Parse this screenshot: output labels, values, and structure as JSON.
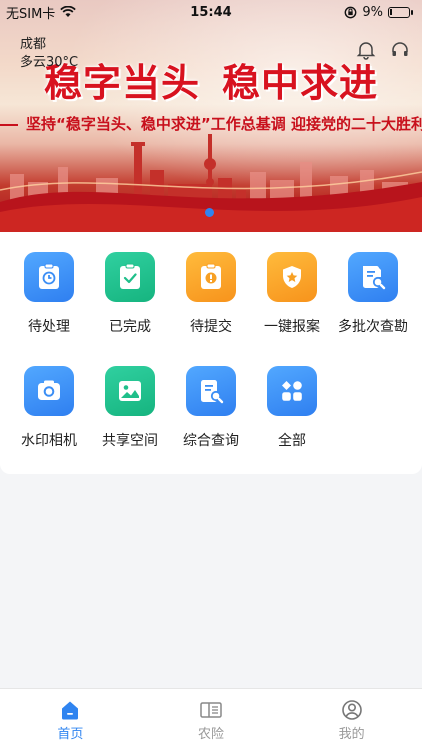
{
  "status_bar": {
    "carrier": "无SIM卡",
    "time": "15:44",
    "battery_percent": "9%",
    "battery_level": 0.09
  },
  "weather": {
    "city": "成都",
    "condition": "多云30°C"
  },
  "banner": {
    "headline_left": "稳字当头",
    "headline_right": "稳中求进",
    "subline": "坚持“稳字当头、稳中求进”工作总基调 迎接党的二十大胜利召"
  },
  "grid_items": [
    {
      "label": "待处理",
      "icon": "clipboard-clock-icon",
      "color": "blue"
    },
    {
      "label": "已完成",
      "icon": "clipboard-check-icon",
      "color": "green"
    },
    {
      "label": "待提交",
      "icon": "clipboard-alert-icon",
      "color": "orange"
    },
    {
      "label": "一键报案",
      "icon": "shield-star-icon",
      "color": "orange"
    },
    {
      "label": "多批次查勘",
      "icon": "document-search-icon",
      "color": "blue"
    },
    {
      "label": "水印相机",
      "icon": "camera-icon",
      "color": "blue"
    },
    {
      "label": "共享空间",
      "icon": "image-icon",
      "color": "green"
    },
    {
      "label": "综合查询",
      "icon": "document-search-icon",
      "color": "blue"
    },
    {
      "label": "全部",
      "icon": "apps-grid-icon",
      "color": "blue"
    }
  ],
  "tabs": [
    {
      "label": "首页",
      "icon": "home-icon",
      "active": true
    },
    {
      "label": "农险",
      "icon": "book-icon",
      "active": false
    },
    {
      "label": "我的",
      "icon": "user-circle-icon",
      "active": false
    }
  ],
  "colors": {
    "accent": "#2f84f0",
    "red_text": "#d8121f"
  }
}
